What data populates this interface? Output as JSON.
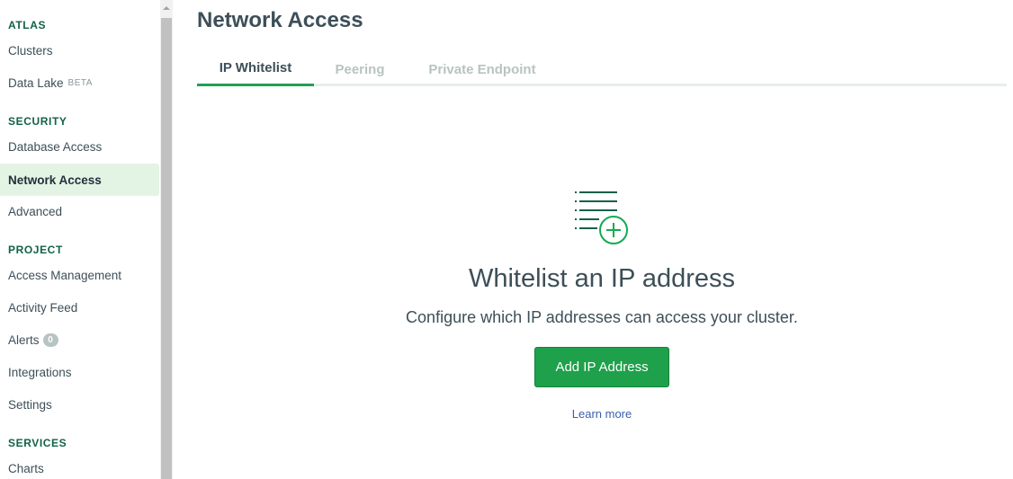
{
  "sidebar": {
    "sections": [
      {
        "title": "ATLAS",
        "items": [
          {
            "label": "Clusters"
          },
          {
            "label": "Data Lake",
            "tag": "BETA"
          }
        ]
      },
      {
        "title": "SECURITY",
        "items": [
          {
            "label": "Database Access"
          },
          {
            "label": "Network Access",
            "active": true
          },
          {
            "label": "Advanced"
          }
        ]
      },
      {
        "title": "PROJECT",
        "items": [
          {
            "label": "Access Management"
          },
          {
            "label": "Activity Feed"
          },
          {
            "label": "Alerts",
            "badge": "0"
          },
          {
            "label": "Integrations"
          },
          {
            "label": "Settings"
          }
        ]
      },
      {
        "title": "SERVICES",
        "items": [
          {
            "label": "Charts"
          }
        ]
      }
    ]
  },
  "page": {
    "title": "Network Access",
    "tabs": [
      {
        "label": "IP Whitelist",
        "active": true
      },
      {
        "label": "Peering"
      },
      {
        "label": "Private Endpoint"
      }
    ]
  },
  "empty_state": {
    "icon": "list-add-icon",
    "title": "Whitelist an IP address",
    "description": "Configure which IP addresses can access your cluster.",
    "button_label": "Add IP Address",
    "link_label": "Learn more"
  },
  "colors": {
    "accent_green": "#1fa04a",
    "active_nav_bg": "#e4f4e4",
    "section_header": "#116149",
    "link": "#3a5eb0"
  }
}
